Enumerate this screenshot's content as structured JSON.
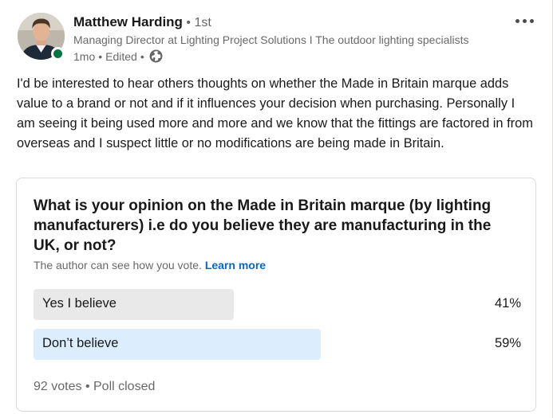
{
  "author": {
    "name": "Matthew Harding",
    "degree": " • 1st",
    "headline": "Managing Director at Lighting Project Solutions I The outdoor lighting specialists",
    "time": "1mo",
    "edited": "Edited",
    "separator": "•",
    "visibility_icon": "globe-icon",
    "presence_color": "#057642"
  },
  "menu_icon": "more-options-icon",
  "post_text": "I'd be interested to hear others thoughts on whether the Made in Britain marque adds value to a brand or not and if it influences your decision when purchasing. Personally I am seeing it being used more and more and we know that the fittings are factored in from overseas and I suspect little or no modifications are being made in Britain.",
  "poll": {
    "question": "What is your opinion on the Made in Britain marque (by lighting manufacturers) i.e do you believe they are manufacturing in the UK, or not?",
    "note": "The author can see how you vote.",
    "learn_more": "Learn more",
    "options": [
      {
        "label": "Yes I believe",
        "percent_text": "41%",
        "percent": 41,
        "fill_color": "#e9e9e9"
      },
      {
        "label": "Don’t believe",
        "percent_text": "59%",
        "percent": 59,
        "fill_color": "#dceefe"
      }
    ],
    "votes": "92 votes",
    "separator": "•",
    "status": "Poll closed"
  },
  "colors": {
    "link": "#0a66c2"
  }
}
